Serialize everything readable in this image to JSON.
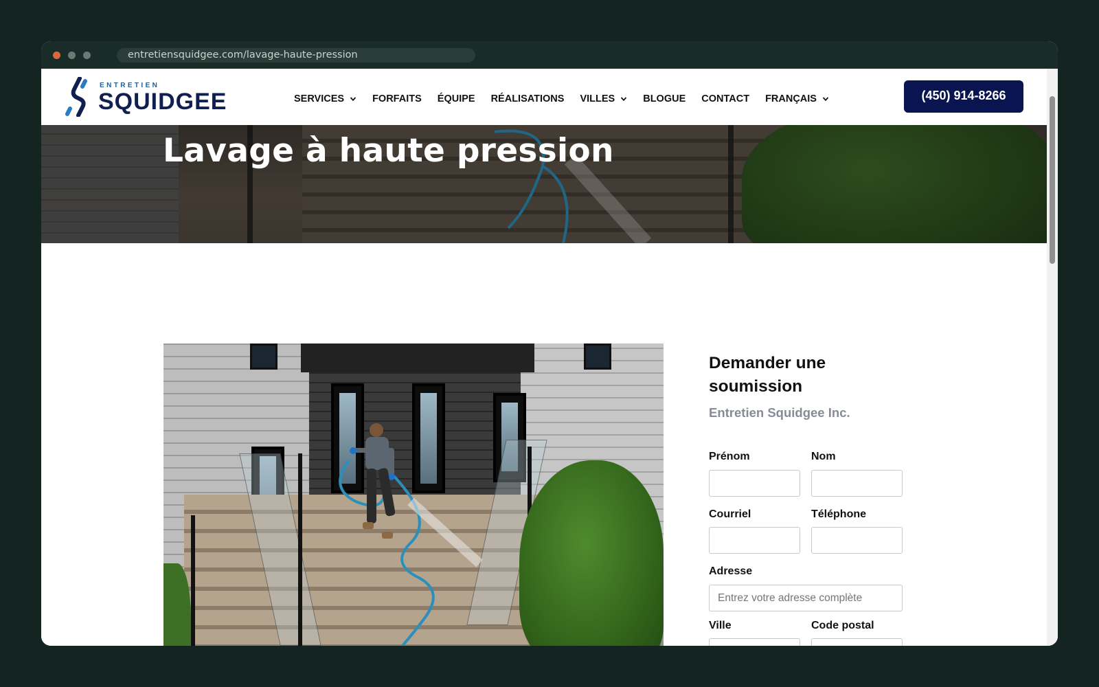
{
  "browser": {
    "url": "entretiensquidgee.com/lavage-haute-pression"
  },
  "header": {
    "logo_small": "ENTRETIEN",
    "logo_big": "SQUIDGEE",
    "nav": [
      {
        "label": "SERVICES",
        "dropdown": true
      },
      {
        "label": "FORFAITS",
        "dropdown": false
      },
      {
        "label": "ÉQUIPE",
        "dropdown": false
      },
      {
        "label": "RÉALISATIONS",
        "dropdown": false
      },
      {
        "label": "VILLES",
        "dropdown": true
      },
      {
        "label": "BLOGUE",
        "dropdown": false
      },
      {
        "label": "CONTACT",
        "dropdown": false
      },
      {
        "label": "FRANÇAIS",
        "dropdown": true
      }
    ],
    "phone": "(450) 914-8266"
  },
  "hero": {
    "title": "Lavage à haute pression"
  },
  "form": {
    "title": "Demander une soumission",
    "subtitle": "Entretien Squidgee Inc.",
    "fields": {
      "first_name": {
        "label": "Prénom",
        "value": ""
      },
      "last_name": {
        "label": "Nom",
        "value": ""
      },
      "email": {
        "label": "Courriel",
        "value": ""
      },
      "phone": {
        "label": "Téléphone",
        "value": ""
      },
      "address": {
        "label": "Adresse",
        "placeholder": "Entrez votre adresse complète",
        "value": ""
      },
      "city": {
        "label": "Ville",
        "value": ""
      },
      "postal_code": {
        "label": "Code postal",
        "value": ""
      }
    }
  },
  "colors": {
    "page_bg": "#142420",
    "brand_navy": "#0a1450",
    "brand_blue": "#1f5f9a",
    "subtitle_gray": "#868b96"
  }
}
